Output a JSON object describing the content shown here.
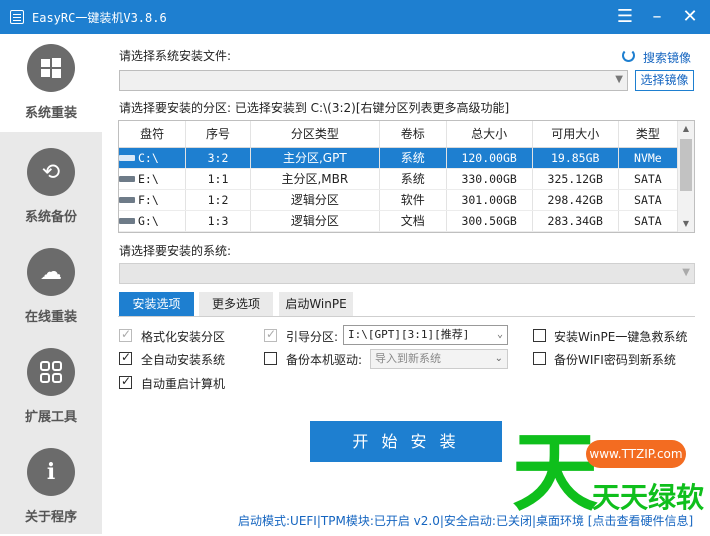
{
  "window": {
    "title": "EasyRC一键装机V3.8.6",
    "menu_icon": "menu-icon",
    "minimize_icon": "minimize-icon",
    "close_icon": "close-icon"
  },
  "sidebar": {
    "items": [
      {
        "label": "系统重装",
        "icon": "windows-icon",
        "active": true
      },
      {
        "label": "系统备份",
        "icon": "backup-icon",
        "active": false
      },
      {
        "label": "在线重装",
        "icon": "cloud-icon",
        "active": false
      },
      {
        "label": "扩展工具",
        "icon": "grid-icon",
        "active": false
      },
      {
        "label": "关于程序",
        "icon": "info-icon",
        "active": false
      }
    ]
  },
  "image_select": {
    "label": "请选择系统安装文件:",
    "search_label": "搜索镜像",
    "value": "",
    "select_button": "选择镜像"
  },
  "partition": {
    "label": "请选择要安装的分区: 已选择安装到 C:\\(3:2)[右键分区列表更多高级功能]",
    "columns": [
      "盘符",
      "序号",
      "分区类型",
      "卷标",
      "总大小",
      "可用大小",
      "类型"
    ],
    "rows": [
      {
        "drive": "C:\\",
        "index": "3:2",
        "ptype": "主分区,GPT",
        "label": "系统",
        "total": "120.00GB",
        "free": "19.85GB",
        "kind": "NVMe",
        "selected": true
      },
      {
        "drive": "E:\\",
        "index": "1:1",
        "ptype": "主分区,MBR",
        "label": "系统",
        "total": "330.00GB",
        "free": "325.12GB",
        "kind": "SATA",
        "selected": false
      },
      {
        "drive": "F:\\",
        "index": "1:2",
        "ptype": "逻辑分区",
        "label": "软件",
        "total": "301.00GB",
        "free": "298.42GB",
        "kind": "SATA",
        "selected": false
      },
      {
        "drive": "G:\\",
        "index": "1:3",
        "ptype": "逻辑分区",
        "label": "文档",
        "total": "300.50GB",
        "free": "283.34GB",
        "kind": "SATA",
        "selected": false
      }
    ]
  },
  "system_select": {
    "label": "请选择要安装的系统:",
    "value": ""
  },
  "tabs": [
    {
      "label": "安装选项",
      "active": true
    },
    {
      "label": "更多选项",
      "active": false
    },
    {
      "label": "启动WinPE",
      "active": false
    }
  ],
  "options": {
    "format": {
      "label": "格式化安装分区",
      "checked": true,
      "disabled": true
    },
    "auto_install": {
      "label": "全自动安装系统",
      "checked": true,
      "disabled": false
    },
    "auto_restart": {
      "label": "自动重启计算机",
      "checked": true,
      "disabled": false
    },
    "boot_partition": {
      "label": "引导分区:",
      "checked": true,
      "disabled": true,
      "value": "I:\\[GPT][3:1][推荐]"
    },
    "backup_drivers": {
      "label": "备份本机驱动:",
      "checked": false,
      "disabled": false,
      "value": "导入到新系统"
    },
    "install_winpe": {
      "label": "安装WinPE一键急救系统",
      "checked": false
    },
    "backup_wifi": {
      "label": "备份WIFI密码到新系统",
      "checked": false
    }
  },
  "start_button": "开 始 安 装",
  "watermark": {
    "big": "天",
    "url": "www.TTZIP.com",
    "text": "天天绿软"
  },
  "status_bar": "启动模式:UEFI|TPM模块:已开启 v2.0|安全启动:已关闭|桌面环境 [点击查看硬件信息]",
  "colors": {
    "accent": "#1e7fd0",
    "sidebar": "#e9e9e9",
    "watermark_green": "#0fbf1c",
    "watermark_orange": "#f36c21"
  }
}
